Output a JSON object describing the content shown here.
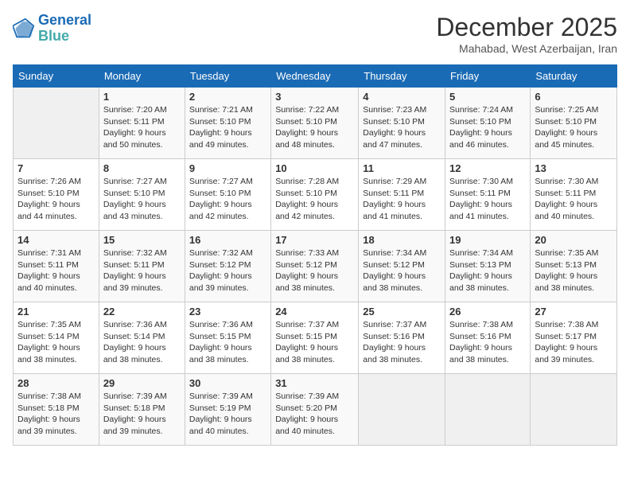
{
  "logo": {
    "line1": "General",
    "line2": "Blue"
  },
  "title": "December 2025",
  "subtitle": "Mahabad, West Azerbaijan, Iran",
  "days_of_week": [
    "Sunday",
    "Monday",
    "Tuesday",
    "Wednesday",
    "Thursday",
    "Friday",
    "Saturday"
  ],
  "weeks": [
    [
      {
        "num": "",
        "detail": ""
      },
      {
        "num": "1",
        "detail": "Sunrise: 7:20 AM\nSunset: 5:11 PM\nDaylight: 9 hours\nand 50 minutes."
      },
      {
        "num": "2",
        "detail": "Sunrise: 7:21 AM\nSunset: 5:10 PM\nDaylight: 9 hours\nand 49 minutes."
      },
      {
        "num": "3",
        "detail": "Sunrise: 7:22 AM\nSunset: 5:10 PM\nDaylight: 9 hours\nand 48 minutes."
      },
      {
        "num": "4",
        "detail": "Sunrise: 7:23 AM\nSunset: 5:10 PM\nDaylight: 9 hours\nand 47 minutes."
      },
      {
        "num": "5",
        "detail": "Sunrise: 7:24 AM\nSunset: 5:10 PM\nDaylight: 9 hours\nand 46 minutes."
      },
      {
        "num": "6",
        "detail": "Sunrise: 7:25 AM\nSunset: 5:10 PM\nDaylight: 9 hours\nand 45 minutes."
      }
    ],
    [
      {
        "num": "7",
        "detail": "Sunrise: 7:26 AM\nSunset: 5:10 PM\nDaylight: 9 hours\nand 44 minutes."
      },
      {
        "num": "8",
        "detail": "Sunrise: 7:27 AM\nSunset: 5:10 PM\nDaylight: 9 hours\nand 43 minutes."
      },
      {
        "num": "9",
        "detail": "Sunrise: 7:27 AM\nSunset: 5:10 PM\nDaylight: 9 hours\nand 42 minutes."
      },
      {
        "num": "10",
        "detail": "Sunrise: 7:28 AM\nSunset: 5:10 PM\nDaylight: 9 hours\nand 42 minutes."
      },
      {
        "num": "11",
        "detail": "Sunrise: 7:29 AM\nSunset: 5:11 PM\nDaylight: 9 hours\nand 41 minutes."
      },
      {
        "num": "12",
        "detail": "Sunrise: 7:30 AM\nSunset: 5:11 PM\nDaylight: 9 hours\nand 41 minutes."
      },
      {
        "num": "13",
        "detail": "Sunrise: 7:30 AM\nSunset: 5:11 PM\nDaylight: 9 hours\nand 40 minutes."
      }
    ],
    [
      {
        "num": "14",
        "detail": "Sunrise: 7:31 AM\nSunset: 5:11 PM\nDaylight: 9 hours\nand 40 minutes."
      },
      {
        "num": "15",
        "detail": "Sunrise: 7:32 AM\nSunset: 5:11 PM\nDaylight: 9 hours\nand 39 minutes."
      },
      {
        "num": "16",
        "detail": "Sunrise: 7:32 AM\nSunset: 5:12 PM\nDaylight: 9 hours\nand 39 minutes."
      },
      {
        "num": "17",
        "detail": "Sunrise: 7:33 AM\nSunset: 5:12 PM\nDaylight: 9 hours\nand 38 minutes."
      },
      {
        "num": "18",
        "detail": "Sunrise: 7:34 AM\nSunset: 5:12 PM\nDaylight: 9 hours\nand 38 minutes."
      },
      {
        "num": "19",
        "detail": "Sunrise: 7:34 AM\nSunset: 5:13 PM\nDaylight: 9 hours\nand 38 minutes."
      },
      {
        "num": "20",
        "detail": "Sunrise: 7:35 AM\nSunset: 5:13 PM\nDaylight: 9 hours\nand 38 minutes."
      }
    ],
    [
      {
        "num": "21",
        "detail": "Sunrise: 7:35 AM\nSunset: 5:14 PM\nDaylight: 9 hours\nand 38 minutes."
      },
      {
        "num": "22",
        "detail": "Sunrise: 7:36 AM\nSunset: 5:14 PM\nDaylight: 9 hours\nand 38 minutes."
      },
      {
        "num": "23",
        "detail": "Sunrise: 7:36 AM\nSunset: 5:15 PM\nDaylight: 9 hours\nand 38 minutes."
      },
      {
        "num": "24",
        "detail": "Sunrise: 7:37 AM\nSunset: 5:15 PM\nDaylight: 9 hours\nand 38 minutes."
      },
      {
        "num": "25",
        "detail": "Sunrise: 7:37 AM\nSunset: 5:16 PM\nDaylight: 9 hours\nand 38 minutes."
      },
      {
        "num": "26",
        "detail": "Sunrise: 7:38 AM\nSunset: 5:16 PM\nDaylight: 9 hours\nand 38 minutes."
      },
      {
        "num": "27",
        "detail": "Sunrise: 7:38 AM\nSunset: 5:17 PM\nDaylight: 9 hours\nand 39 minutes."
      }
    ],
    [
      {
        "num": "28",
        "detail": "Sunrise: 7:38 AM\nSunset: 5:18 PM\nDaylight: 9 hours\nand 39 minutes."
      },
      {
        "num": "29",
        "detail": "Sunrise: 7:39 AM\nSunset: 5:18 PM\nDaylight: 9 hours\nand 39 minutes."
      },
      {
        "num": "30",
        "detail": "Sunrise: 7:39 AM\nSunset: 5:19 PM\nDaylight: 9 hours\nand 40 minutes."
      },
      {
        "num": "31",
        "detail": "Sunrise: 7:39 AM\nSunset: 5:20 PM\nDaylight: 9 hours\nand 40 minutes."
      },
      {
        "num": "",
        "detail": ""
      },
      {
        "num": "",
        "detail": ""
      },
      {
        "num": "",
        "detail": ""
      }
    ]
  ]
}
